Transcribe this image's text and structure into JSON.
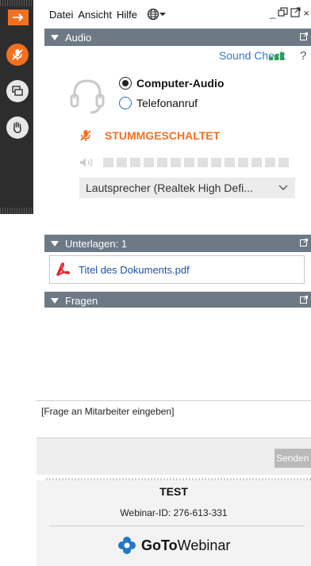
{
  "menu": {
    "items": [
      "Datei",
      "Ansicht",
      "Hilfe"
    ],
    "globe_icon": "globe-icon"
  },
  "window_controls": {
    "icons": [
      "minimize-icon",
      "restore-icon",
      "popout-icon",
      "close-icon"
    ],
    "minimize": "_",
    "close": "×"
  },
  "rail": {
    "toggle_icon": "arrow-right-icon",
    "buttons": [
      "microphone-muted-icon",
      "screen-share-icon",
      "raise-hand-icon"
    ],
    "accent_color": "#f37021"
  },
  "audio": {
    "header": "Audio",
    "sound_check": "Sound Check",
    "help": "?",
    "options": [
      {
        "label": "Computer-Audio",
        "selected": true
      },
      {
        "label": "Telefonanruf",
        "selected": false
      }
    ],
    "status": "STUMMGESCHALTET",
    "speaker": "Lautsprecher (Realtek High Defi...",
    "level_segments": 14,
    "signal_bars": 3
  },
  "documents": {
    "header": "Unterlagen: 1",
    "items": [
      {
        "name": "Titel des Dokuments.pdf",
        "icon": "pdf-icon"
      }
    ]
  },
  "questions": {
    "header": "Fragen",
    "input_placeholder": "[Frage an Mitarbeiter eingeben]",
    "send_label": "Senden"
  },
  "footer": {
    "title": "TEST",
    "webinar_id": "Webinar-ID: 276-613-331",
    "logo_goto": "GoTo",
    "logo_webinar": "Webinar"
  },
  "colors": {
    "accent": "#f37021",
    "header_bg": "#6d7a86",
    "link": "#2f7bc4",
    "signal": "#2aa34a"
  }
}
